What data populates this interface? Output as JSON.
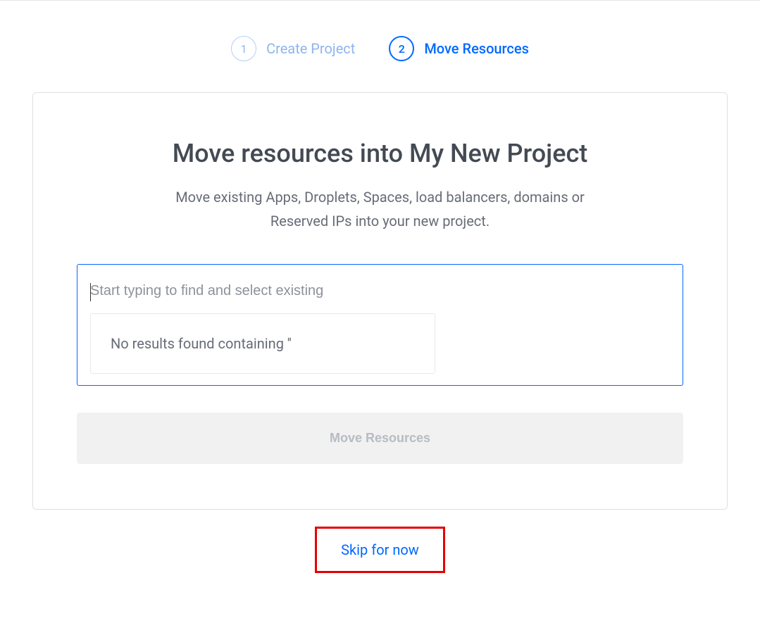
{
  "stepper": {
    "steps": [
      {
        "num": "1",
        "label": "Create Project",
        "state": "inactive"
      },
      {
        "num": "2",
        "label": "Move Resources",
        "state": "active"
      }
    ]
  },
  "card": {
    "title": "Move resources into My New Project",
    "subtext": "Move existing Apps, Droplets, Spaces, load balancers, domains or Reserved IPs into your new project."
  },
  "search": {
    "placeholder": "Start typing to find and select existing",
    "value": "",
    "no_results_text": "No results found containing ''"
  },
  "buttons": {
    "move_label": "Move Resources",
    "skip_label": "Skip for now"
  }
}
